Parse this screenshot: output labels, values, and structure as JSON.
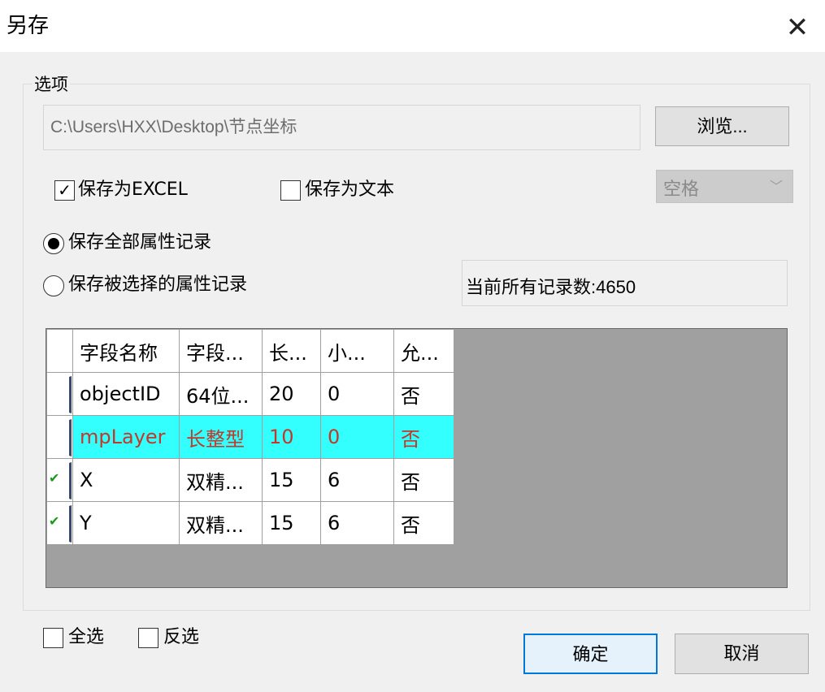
{
  "window": {
    "title": "另存",
    "close_glyph": "✕"
  },
  "options": {
    "group_label": "选项",
    "path": "C:\\Users\\HXX\\Desktop\\节点坐标",
    "browse_label": "浏览...",
    "save_excel": {
      "label": "保存为EXCEL",
      "checked": true
    },
    "save_text": {
      "label": "保存为文本",
      "checked": false
    },
    "delimiter": {
      "selected": "空格"
    },
    "radio_all": {
      "label": "保存全部属性记录",
      "selected": true
    },
    "radio_selected": {
      "label": "保存被选择的属性记录",
      "selected": false
    },
    "record_count": "当前所有记录数:4650"
  },
  "grid": {
    "headers": [
      "字段名称",
      "字段...",
      "长...",
      "小...",
      "允..."
    ],
    "rows": [
      {
        "cells": [
          "objectID",
          "64位...",
          "20",
          "0",
          "否"
        ],
        "checked": false,
        "highlighted": false
      },
      {
        "cells": [
          "mpLayer",
          "长整型",
          "10",
          "0",
          "否"
        ],
        "checked": false,
        "highlighted": true
      },
      {
        "cells": [
          "X",
          "双精...",
          "15",
          "6",
          "否"
        ],
        "checked": true,
        "highlighted": false
      },
      {
        "cells": [
          "Y",
          "双精...",
          "15",
          "6",
          "否"
        ],
        "checked": true,
        "highlighted": false
      }
    ],
    "colors": {
      "highlight_bg": "#33ffff",
      "highlight_text": "#c0392b",
      "empty_area": "#a0a0a0"
    }
  },
  "footer": {
    "select_all": "全选",
    "invert": "反选",
    "ok_label": "确定",
    "cancel_label": "取消"
  }
}
